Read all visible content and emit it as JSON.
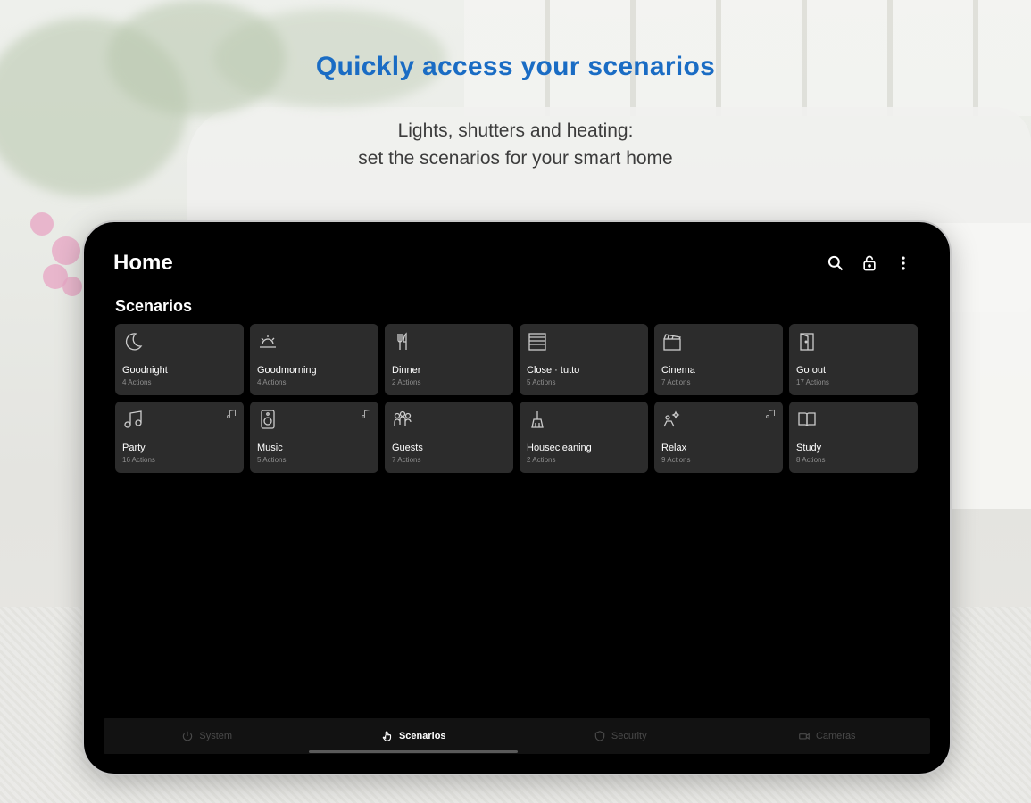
{
  "promo": {
    "headline": "Quickly access your scenarios",
    "subline_1": "Lights, shutters and heating:",
    "subline_2": "set the scenarios for your smart home"
  },
  "app": {
    "title": "Home",
    "actions": [
      {
        "icon": "search-icon"
      },
      {
        "icon": "lock-icon"
      },
      {
        "icon": "more-vert-icon"
      }
    ],
    "section_title": "Scenarios",
    "scenarios": [
      {
        "name": "Goodnight",
        "count": "4 Actions",
        "icon": "moon-icon",
        "badge": false
      },
      {
        "name": "Goodmorning",
        "count": "4 Actions",
        "icon": "sunrise-icon",
        "badge": false
      },
      {
        "name": "Dinner",
        "count": "2 Actions",
        "icon": "cutlery-icon",
        "badge": false
      },
      {
        "name": "Close · tutto",
        "count": "5 Actions",
        "icon": "shutter-icon",
        "badge": false
      },
      {
        "name": "Cinema",
        "count": "7 Actions",
        "icon": "clapperboard-icon",
        "badge": false
      },
      {
        "name": "Go out",
        "count": "17 Actions",
        "icon": "door-icon",
        "badge": false
      },
      {
        "name": "Party",
        "count": "16 Actions",
        "icon": "music-note-icon",
        "badge": true
      },
      {
        "name": "Music",
        "count": "5 Actions",
        "icon": "speaker-icon",
        "badge": true
      },
      {
        "name": "Guests",
        "count": "7 Actions",
        "icon": "people-icon",
        "badge": false
      },
      {
        "name": "Housecleaning",
        "count": "2 Actions",
        "icon": "cleaning-icon",
        "badge": false
      },
      {
        "name": "Relax",
        "count": "9 Actions",
        "icon": "relax-icon",
        "badge": true
      },
      {
        "name": "Study",
        "count": "8 Actions",
        "icon": "book-icon",
        "badge": false
      }
    ],
    "nav": [
      {
        "label": "System",
        "icon": "power-icon",
        "active": false
      },
      {
        "label": "Scenarios",
        "icon": "touch-icon",
        "active": true
      },
      {
        "label": "Security",
        "icon": "shield-icon",
        "active": false
      },
      {
        "label": "Cameras",
        "icon": "camera-icon",
        "active": false
      }
    ]
  },
  "colors": {
    "headline": "#1a6cc4",
    "tile_bg": "#2c2c2c",
    "screen_bg": "#000000"
  }
}
